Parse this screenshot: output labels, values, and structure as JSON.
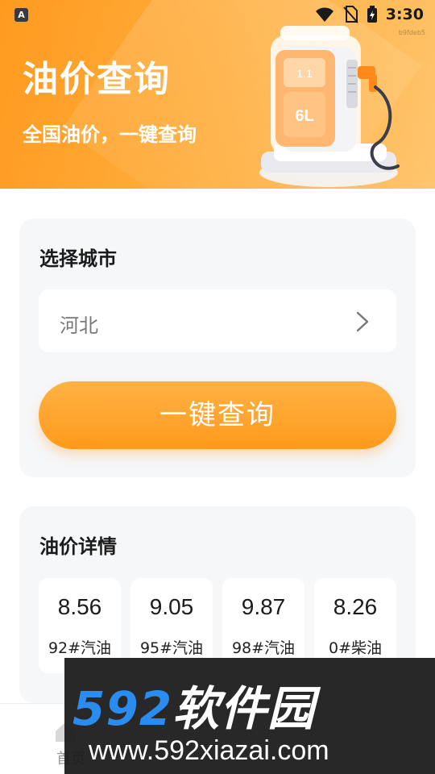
{
  "status_bar": {
    "app_icon_letter": "A",
    "time": "3:30"
  },
  "header": {
    "title": "油价查询",
    "subtitle": "全国油价，一键查询",
    "mark": "b9fdeb5",
    "pump_screen_top": "1.1",
    "pump_screen_bottom": "6L"
  },
  "city_card": {
    "title": "选择城市",
    "selected_city": "河北",
    "query_button_label": "一键查询"
  },
  "detail_card": {
    "title": "油价详情",
    "prices": [
      {
        "value": "8.56",
        "label": "92#汽油"
      },
      {
        "value": "9.05",
        "label": "95#汽油"
      },
      {
        "value": "9.87",
        "label": "98#汽油"
      },
      {
        "value": "8.26",
        "label": "0#柴油"
      }
    ]
  },
  "bottom_nav": {
    "home_label": "首页"
  },
  "watermark": {
    "brand_number": "592",
    "brand_text": "软件园",
    "url": "www.592xiazai.com"
  },
  "colors": {
    "accent": "#ff9a1c",
    "header_start": "#ff9a1f",
    "header_end": "#ffc56e",
    "card_bg": "#f6f7f9",
    "watermark_blue": "#2b8cf0"
  }
}
